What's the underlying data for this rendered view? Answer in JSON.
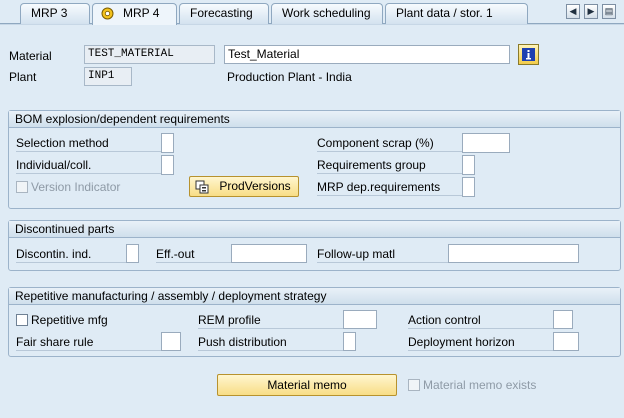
{
  "tabs": [
    {
      "label": "MRP 3",
      "active": false
    },
    {
      "label": "MRP 4",
      "active": true
    },
    {
      "label": "Forecasting",
      "active": false
    },
    {
      "label": "Work scheduling",
      "active": false
    },
    {
      "label": "Plant data / stor. 1",
      "active": false
    }
  ],
  "header": {
    "material_label": "Material",
    "material_value": "TEST_MATERIAL",
    "material_desc": "Test_Material",
    "plant_label": "Plant",
    "plant_value": "INP1",
    "plant_desc": "Production Plant - India"
  },
  "bom": {
    "title": "BOM explosion/dependent requirements",
    "selection_method": "Selection method",
    "individual_coll": "Individual/coll.",
    "version_indicator": "Version Indicator",
    "prodversions_btn": "ProdVersions",
    "component_scrap": "Component scrap (%)",
    "requirements_group": "Requirements group",
    "mrp_dep_requirements": "MRP dep.requirements"
  },
  "discontinued": {
    "title": "Discontinued parts",
    "discontin_ind": "Discontin. ind.",
    "eff_out": "Eff.-out",
    "follow_up": "Follow-up matl"
  },
  "repetitive": {
    "title": "Repetitive manufacturing / assembly / deployment strategy",
    "repetitive_mfg": "Repetitive mfg",
    "fair_share": "Fair share rule",
    "rem_profile": "REM profile",
    "push_distribution": "Push distribution",
    "action_control": "Action control",
    "deployment_horizon": "Deployment horizon"
  },
  "footer": {
    "material_memo_btn": "Material memo",
    "material_memo_exists": "Material memo exists"
  }
}
